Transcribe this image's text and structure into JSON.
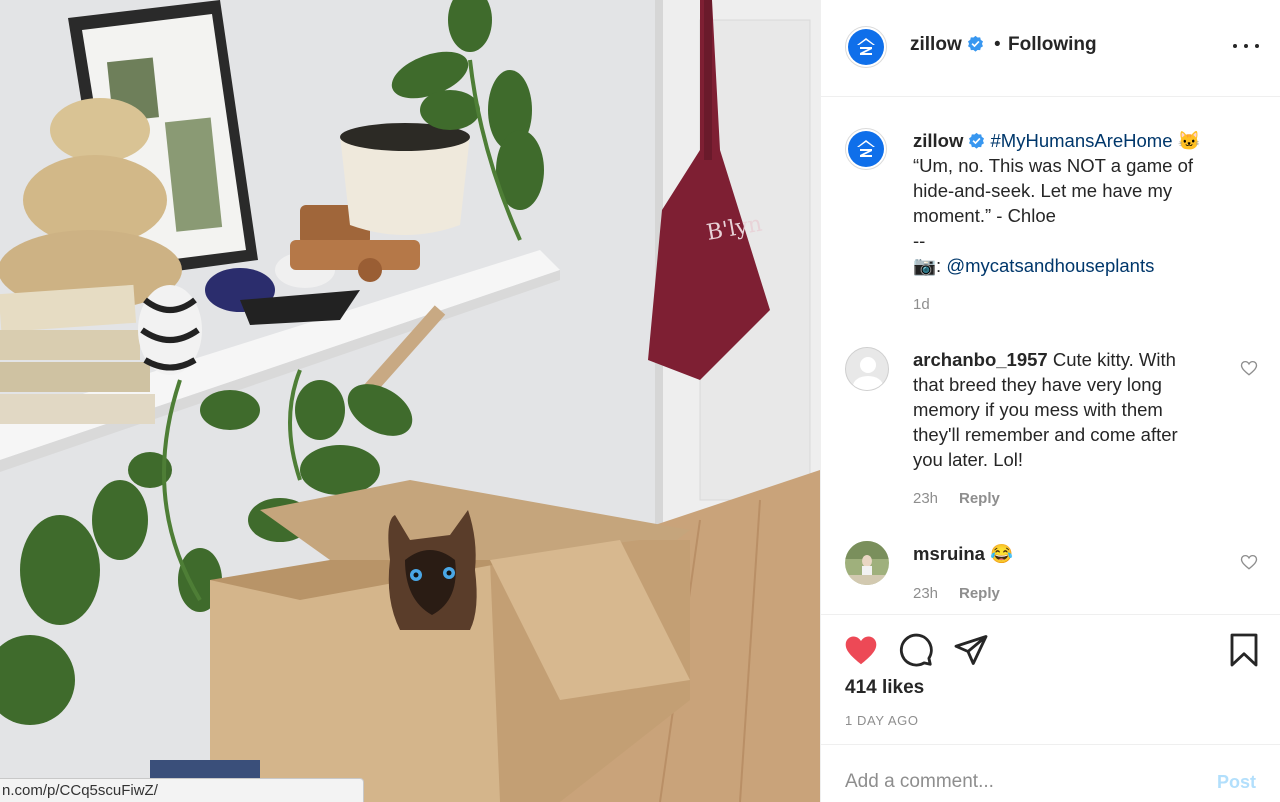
{
  "photo": {
    "alt_subject": "siamese-cat-in-cardboard-box",
    "status_url": "n.com/p/CCq5scuFiwZ/"
  },
  "header": {
    "username": "zillow",
    "separator": "•",
    "follow_state": "Following"
  },
  "caption": {
    "username": "zillow",
    "hashtag": "#MyHumansAreHome",
    "emoji": "🐱",
    "lines": [
      "“Um, no. This was NOT a game of",
      "hide-and-seek. Let me have my",
      "moment.” - Chloe",
      "--"
    ],
    "credit_prefix": "📷: ",
    "credit_handle": "@mycatsandhouseplants",
    "time": "1d"
  },
  "comments": [
    {
      "username": "archanbo_1957",
      "text_lines": [
        "Cute kitty. With",
        "that breed they have very long",
        "memory if you mess with them",
        "they'll remember and come after",
        "you later. Lol!"
      ],
      "time": "23h",
      "reply_label": "Reply"
    },
    {
      "username": "msruina",
      "text": "😂",
      "time": "23h",
      "reply_label": "Reply"
    }
  ],
  "actions": {
    "likes": "414 likes",
    "date": "1 DAY AGO"
  },
  "add_comment": {
    "placeholder": "Add a comment...",
    "post_label": "Post"
  },
  "colors": {
    "brand_blue": "#0f6fea",
    "like_red": "#ed4956",
    "link_blue": "#00376b",
    "post_disabled": "#b2dffc"
  }
}
